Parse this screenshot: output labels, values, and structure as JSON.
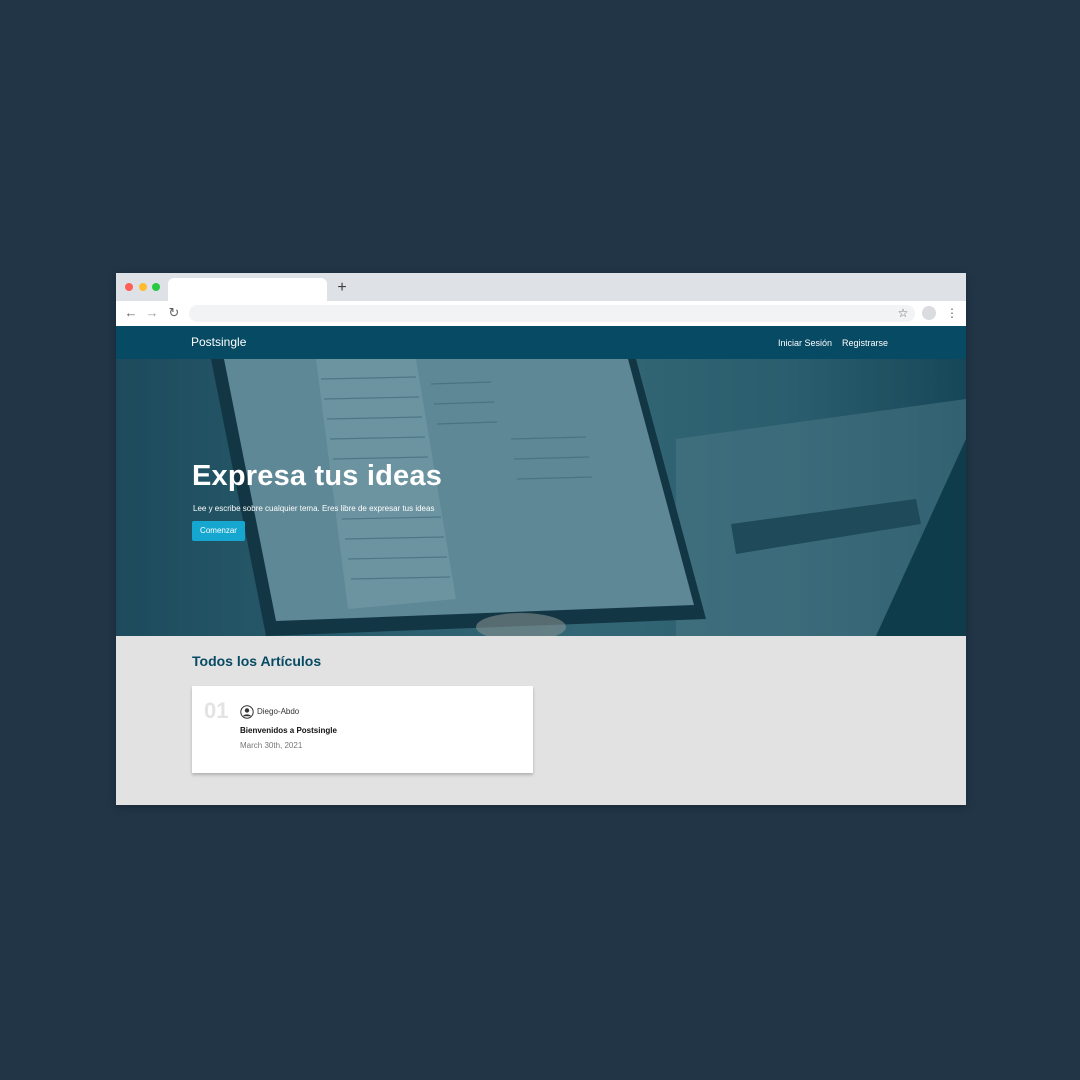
{
  "browser": {
    "new_tab_glyph": "+",
    "back_glyph": "←",
    "forward_glyph": "→",
    "reload_glyph": "↻",
    "star_glyph": "☆",
    "menu_glyph": "⋮"
  },
  "site": {
    "brand": "Postsingle",
    "nav": {
      "login": "Iniciar Sesión",
      "register": "Registrarse"
    },
    "colors": {
      "primary": "#064a63",
      "accent": "#16a7d0",
      "background": "#213547"
    }
  },
  "hero": {
    "title": "Expresa tus ideas",
    "subtitle": "Lee y escribe sobre cualquier tema. Eres libre de expresar tus ideas",
    "cta": "Comenzar"
  },
  "articles": {
    "heading": "Todos los Artículos",
    "items": [
      {
        "number": "01",
        "author": "Diego-Abdo",
        "title": "Bienvenidos a Postsingle",
        "date": "March 30th, 2021"
      }
    ]
  }
}
